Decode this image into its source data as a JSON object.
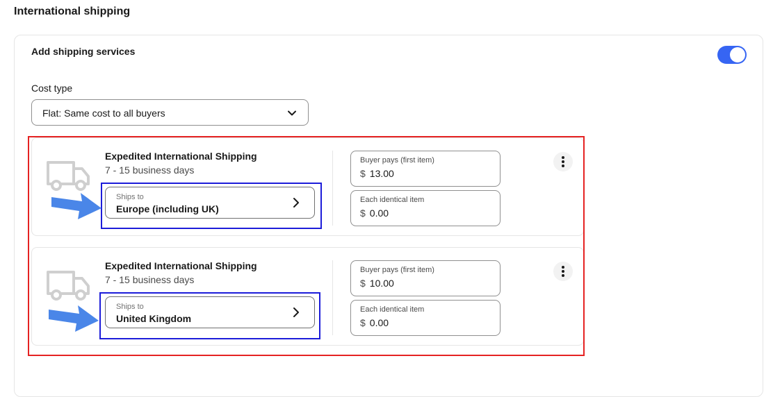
{
  "section_title": "International shipping",
  "card": {
    "title": "Add shipping services",
    "toggle_on": true
  },
  "cost_type": {
    "label": "Cost type",
    "value": "Flat: Same cost to all buyers"
  },
  "services": [
    {
      "name": "Expedited International Shipping",
      "days": "7 - 15 business days",
      "ships_to_label": "Ships to",
      "ships_to_value": "Europe (including UK)",
      "buyer_pays_label": "Buyer pays (first item)",
      "buyer_pays_currency": "$",
      "buyer_pays_value": "13.00",
      "each_item_label": "Each identical item",
      "each_item_currency": "$",
      "each_item_value": "0.00"
    },
    {
      "name": "Expedited International Shipping",
      "days": "7 - 15 business days",
      "ships_to_label": "Ships to",
      "ships_to_value": "United Kingdom",
      "buyer_pays_label": "Buyer pays (first item)",
      "buyer_pays_currency": "$",
      "buyer_pays_value": "10.00",
      "each_item_label": "Each identical item",
      "each_item_currency": "$",
      "each_item_value": "0.00"
    }
  ],
  "colors": {
    "toggle": "#3665f3",
    "highlight_red": "#e52222",
    "highlight_blue": "#1c1cd9",
    "arrow_blue": "#4a86e8"
  },
  "icons": [
    "chevron-down-icon",
    "truck-icon",
    "chevron-right-icon",
    "more-vertical-icon",
    "arrow-right-icon"
  ]
}
